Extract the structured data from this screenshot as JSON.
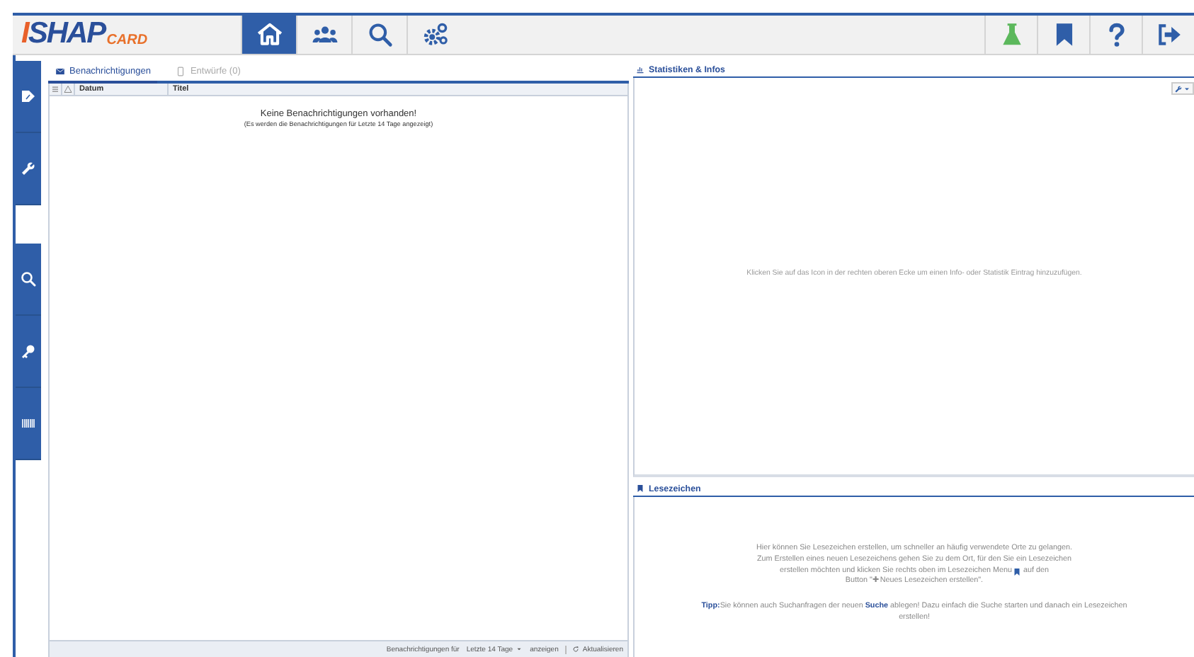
{
  "header": {
    "logo": {
      "main": "ISHAP",
      "sub": "CARD"
    },
    "nav": [
      {
        "kind": "home",
        "selected": true
      },
      {
        "kind": "users",
        "selected": false
      },
      {
        "kind": "search",
        "selected": false
      },
      {
        "kind": "gears",
        "selected": false
      }
    ],
    "tools": [
      {
        "kind": "flask"
      },
      {
        "kind": "bookmark"
      },
      {
        "kind": "help"
      },
      {
        "kind": "logout"
      }
    ]
  },
  "sidebar": {
    "groups": [
      [
        {
          "kind": "tag"
        },
        {
          "kind": "wrench"
        }
      ],
      [
        {
          "kind": "search"
        },
        {
          "kind": "key"
        },
        {
          "kind": "barcode"
        }
      ]
    ]
  },
  "notifications": {
    "tabs": [
      {
        "label": "Benachrichtigungen",
        "kind": "envelope",
        "selected": true
      },
      {
        "label": "Entwürfe (0)",
        "kind": "phone",
        "selected": false
      }
    ],
    "columns": [
      {
        "kind": "list"
      },
      {
        "kind": "warning"
      },
      {
        "kind": "text",
        "label": "Datum"
      },
      {
        "kind": "text",
        "label": "Titel"
      }
    ],
    "empty": {
      "title": "Keine Benachrichtigungen vorhanden!",
      "note": "(Es werden die Benachrichtigungen für Letzte 14 Tage angezeigt)"
    },
    "footer": {
      "label": "Benachrichtigungen für",
      "period": "Letzte 14 Tage",
      "show": "anzeigen",
      "refresh": "Aktualisieren"
    }
  },
  "stats": {
    "title": "Statistiken & Infos",
    "hint": "Klicken Sie auf das Icon in der rechten oberen Ecke um einen Info- oder Statistik Eintrag hinzuzufügen."
  },
  "bookmarks": {
    "title": "Lesezeichen",
    "hint_lines": [
      {
        "kind": "text",
        "text": "Hier können Sie Lesezeichen erstellen, um schneller an häufig verwendete Orte zu gelangen."
      },
      {
        "kind": "text",
        "text": "Zum Erstellen eines neuen Lesezeichens gehen Sie zu dem Ort, für den Sie ein Lesezeichen"
      },
      {
        "kind": "icon",
        "before": "erstellen möchten und klicken Sie rechts oben im Lesezeichen Menu",
        "after": "auf den"
      },
      {
        "kind": "text",
        "text": "Button \"✚ Neues Lesezeichen erstellen\"."
      }
    ],
    "tip": "**Tipp:**Sie können auch Suchanfragen der neuen **Suche** ablegen! Dazu einfach die Suche starten und danach ein Lesezeichen erstellen!"
  }
}
